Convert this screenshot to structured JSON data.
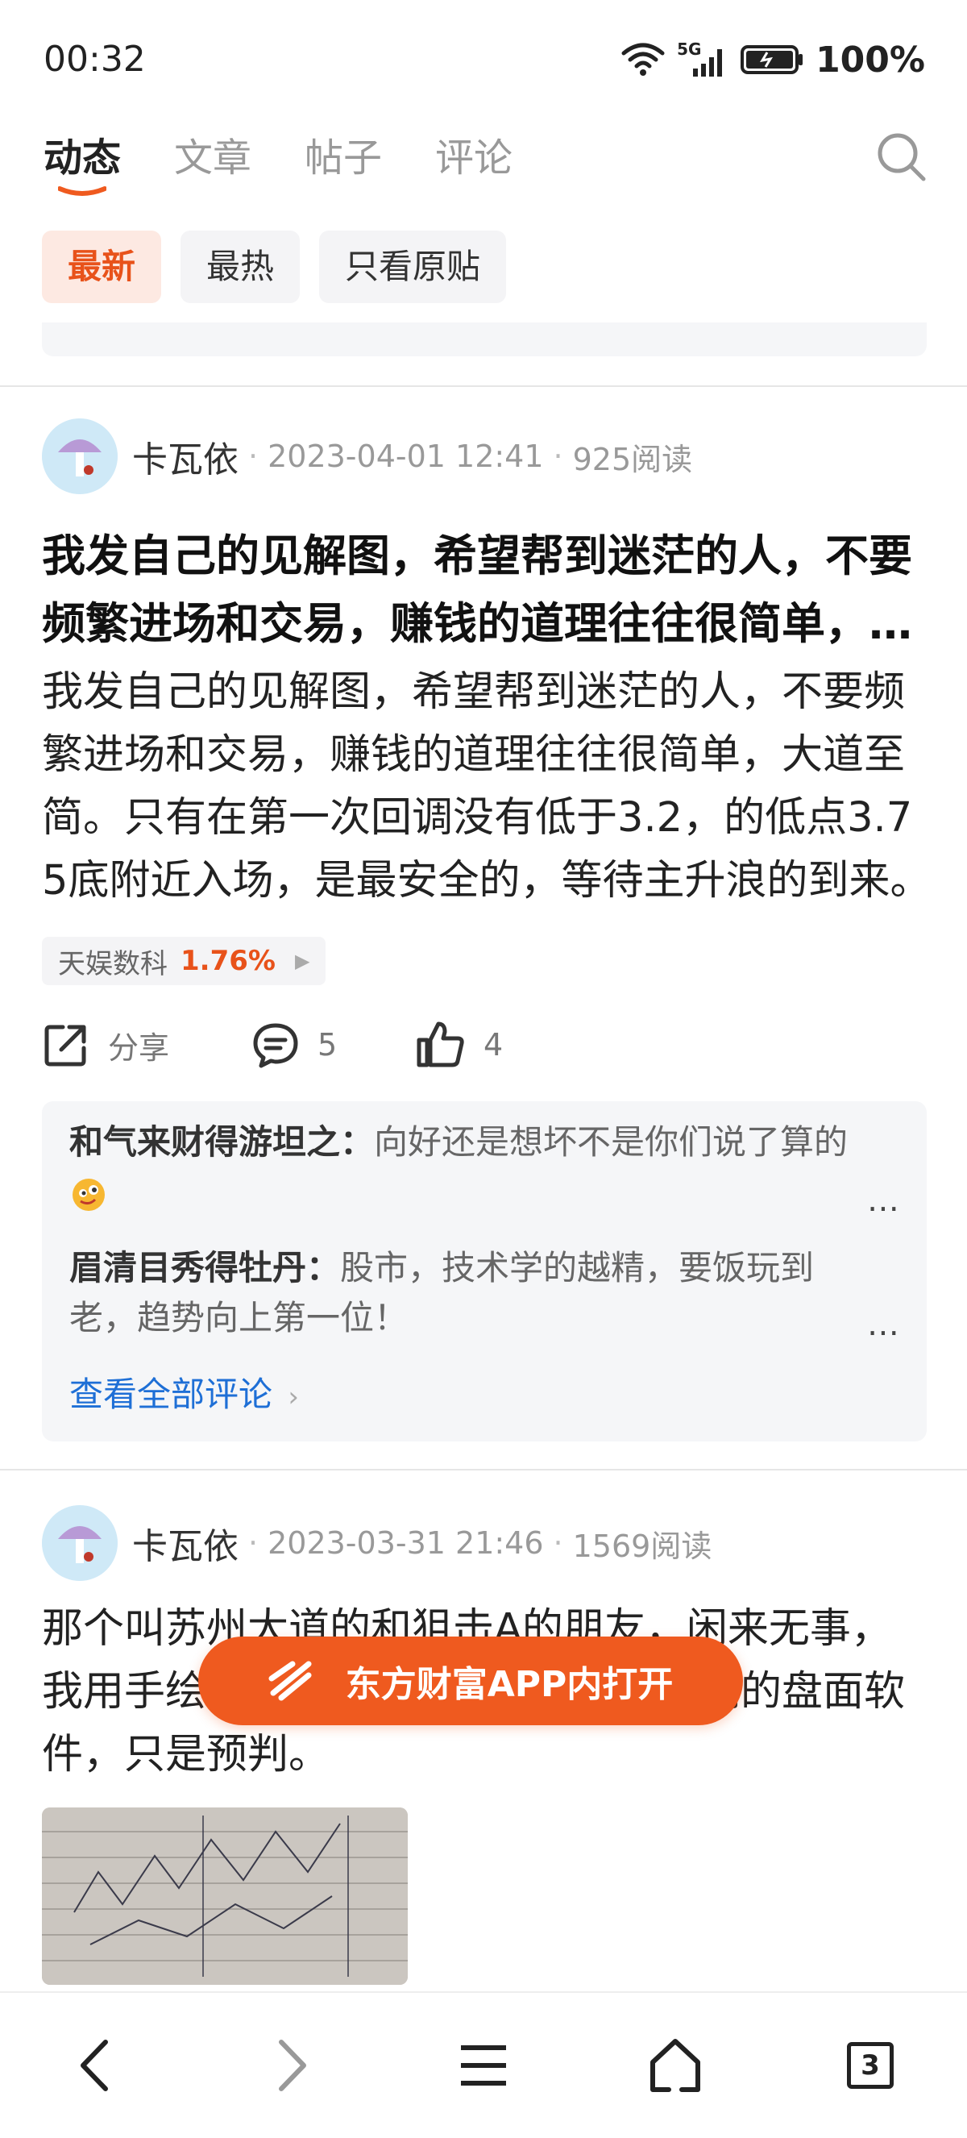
{
  "status_bar": {
    "time": "00:32",
    "battery": "100%",
    "network": "5G"
  },
  "tabs": [
    {
      "label": "动态",
      "active": true
    },
    {
      "label": "文章",
      "active": false
    },
    {
      "label": "帖子",
      "active": false
    },
    {
      "label": "评论",
      "active": false
    }
  ],
  "filters": [
    {
      "label": "最新",
      "active": true
    },
    {
      "label": "最热",
      "active": false
    },
    {
      "label": "只看原贴",
      "active": false
    }
  ],
  "posts": [
    {
      "author": "卡瓦依",
      "date": "2023-04-01 12:41",
      "reads": "925阅读",
      "title": "我发自己的见解图，希望帮到迷茫的人，不要频繁进场和交易，赚钱的道理往往很简单，大道至简。",
      "body": "我发自己的见解图，希望帮到迷茫的人，不要频繁进场和交易，赚钱的道理往往很简单，大道至简。只有在第一次回调没有低于3.2，的低点3.75底附近入场，是最安全的，等待主升浪的到来。",
      "stock": {
        "name": "天娱数科",
        "change": "1.76%"
      },
      "actions": {
        "share": "分享",
        "comments": "5",
        "likes": "4"
      },
      "comments": [
        {
          "name": "和气来财得游坦之：",
          "text": "向好还是想坏不是你们说了算的"
        },
        {
          "name": "眉清目秀得牡丹：",
          "text": "股市，技术学的越精，要饭玩到老，趋势向上第一位！"
        }
      ],
      "view_all": "查看全部评论"
    },
    {
      "author": "卡瓦依",
      "date": "2023-03-31 21:46",
      "reads": "1569阅读",
      "body": "那个叫苏州大道的和狙击A的朋友，闲来无事，我用手绘图演示给你们，你们结合你们的盘面软件，只是预判。"
    }
  ],
  "open_app_button": "东方财富APP内打开",
  "bottom_nav": {
    "tab_count": "3"
  },
  "colors": {
    "accent": "#ef5a1f",
    "link": "#1e6fd6",
    "stock_up": "#e8521a"
  }
}
